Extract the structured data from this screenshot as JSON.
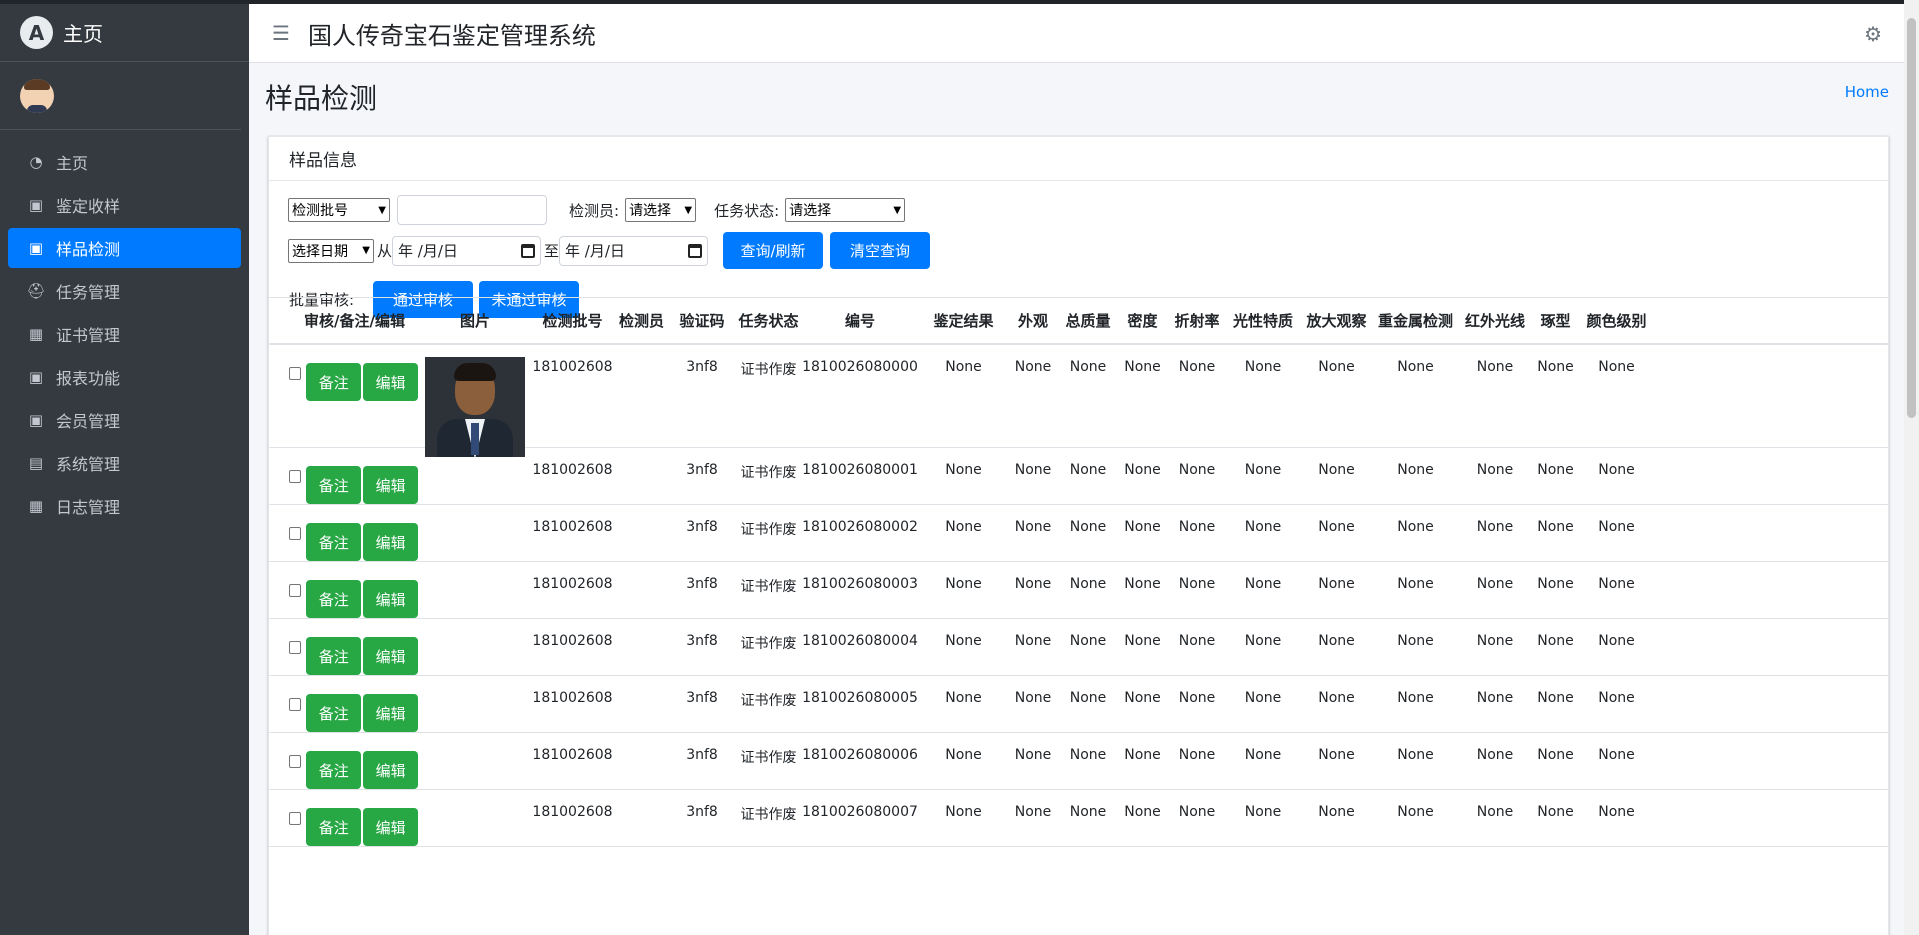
{
  "sidebar": {
    "brand": "主页",
    "brand_logo": "A",
    "items": [
      {
        "label": "主页",
        "icon": "dashboard-icon",
        "active": false
      },
      {
        "label": "鉴定收样",
        "icon": "chalkboard-icon",
        "active": false
      },
      {
        "label": "样品检测",
        "icon": "chalkboard-icon",
        "active": true
      },
      {
        "label": "任务管理",
        "icon": "graduate-icon",
        "active": false
      },
      {
        "label": "证书管理",
        "icon": "grid-icon",
        "active": false
      },
      {
        "label": "报表功能",
        "icon": "chalkboard-icon",
        "active": false
      },
      {
        "label": "会员管理",
        "icon": "chalkboard-icon",
        "active": false
      },
      {
        "label": "系统管理",
        "icon": "book-icon",
        "active": false
      },
      {
        "label": "日志管理",
        "icon": "grid-icon",
        "active": false
      }
    ]
  },
  "header": {
    "title": "国人传奇宝石鉴定管理系统"
  },
  "page": {
    "title": "样品检测",
    "breadcrumb": "Home"
  },
  "card": {
    "title": "样品信息"
  },
  "filters": {
    "field_select": "检测批号",
    "inspector_label": "检测员:",
    "inspector_select": "请选择",
    "status_label": "任务状态:",
    "status_select": "请选择",
    "date_select": "选择日期",
    "from_label": "从",
    "to_label": "至",
    "date_placeholder": "年 /月/日",
    "query_button": "查询/刷新",
    "clear_button": "清空查询",
    "batch_label": "批量审核:",
    "pass_button": "通过审核",
    "fail_button": "未通过审核"
  },
  "table": {
    "headers": [
      "审核/备注/编辑",
      "图片",
      "检测批号",
      "检测员",
      "验证码",
      "任务状态",
      "编号",
      "鉴定结果",
      "外观",
      "总质量",
      "密度",
      "折射率",
      "光性特质",
      "放大观察",
      "重金属检测",
      "红外光线",
      "琢型",
      "颜色级别"
    ],
    "note_label": "备注",
    "edit_label": "编辑",
    "rows": [
      {
        "batch": "181002608",
        "inspector": "",
        "code": "3nf8",
        "status": "证书作废",
        "number": "1810026080000",
        "result": "None",
        "appearance": "None",
        "mass": "None",
        "density": "None",
        "ri": "None",
        "optical": "None",
        "magnify": "None",
        "metal": "None",
        "ir": "None",
        "cut": "None",
        "color": "None",
        "photo": true
      },
      {
        "batch": "181002608",
        "inspector": "",
        "code": "3nf8",
        "status": "证书作废",
        "number": "1810026080001",
        "result": "None",
        "appearance": "None",
        "mass": "None",
        "density": "None",
        "ri": "None",
        "optical": "None",
        "magnify": "None",
        "metal": "None",
        "ir": "None",
        "cut": "None",
        "color": "None",
        "photo": false
      },
      {
        "batch": "181002608",
        "inspector": "",
        "code": "3nf8",
        "status": "证书作废",
        "number": "1810026080002",
        "result": "None",
        "appearance": "None",
        "mass": "None",
        "density": "None",
        "ri": "None",
        "optical": "None",
        "magnify": "None",
        "metal": "None",
        "ir": "None",
        "cut": "None",
        "color": "None",
        "photo": false
      },
      {
        "batch": "181002608",
        "inspector": "",
        "code": "3nf8",
        "status": "证书作废",
        "number": "1810026080003",
        "result": "None",
        "appearance": "None",
        "mass": "None",
        "density": "None",
        "ri": "None",
        "optical": "None",
        "magnify": "None",
        "metal": "None",
        "ir": "None",
        "cut": "None",
        "color": "None",
        "photo": false
      },
      {
        "batch": "181002608",
        "inspector": "",
        "code": "3nf8",
        "status": "证书作废",
        "number": "1810026080004",
        "result": "None",
        "appearance": "None",
        "mass": "None",
        "density": "None",
        "ri": "None",
        "optical": "None",
        "magnify": "None",
        "metal": "None",
        "ir": "None",
        "cut": "None",
        "color": "None",
        "photo": false
      },
      {
        "batch": "181002608",
        "inspector": "",
        "code": "3nf8",
        "status": "证书作废",
        "number": "1810026080005",
        "result": "None",
        "appearance": "None",
        "mass": "None",
        "density": "None",
        "ri": "None",
        "optical": "None",
        "magnify": "None",
        "metal": "None",
        "ir": "None",
        "cut": "None",
        "color": "None",
        "photo": false
      },
      {
        "batch": "181002608",
        "inspector": "",
        "code": "3nf8",
        "status": "证书作废",
        "number": "1810026080006",
        "result": "None",
        "appearance": "None",
        "mass": "None",
        "density": "None",
        "ri": "None",
        "optical": "None",
        "magnify": "None",
        "metal": "None",
        "ir": "None",
        "cut": "None",
        "color": "None",
        "photo": false
      },
      {
        "batch": "181002608",
        "inspector": "",
        "code": "3nf8",
        "status": "证书作废",
        "number": "1810026080007",
        "result": "None",
        "appearance": "None",
        "mass": "None",
        "density": "None",
        "ri": "None",
        "optical": "None",
        "magnify": "None",
        "metal": "None",
        "ir": "None",
        "cut": "None",
        "color": "None",
        "photo": false
      }
    ]
  },
  "colors": {
    "primary": "#007bff",
    "success": "#28a745",
    "sidebar": "#343a40"
  }
}
